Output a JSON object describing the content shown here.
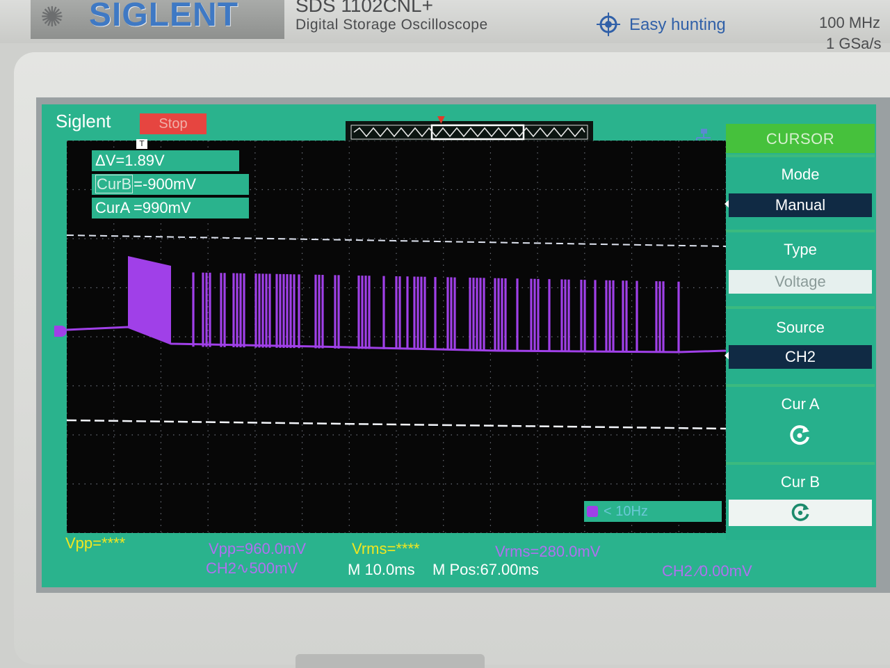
{
  "device": {
    "brand": "SIGLENT",
    "model": "SDS 1102CNL+",
    "subtitle": "Digital Storage Oscilloscope",
    "feature": "Easy hunting",
    "bandwidth": "100 MHz",
    "sample_rate": "1 GSa/s"
  },
  "screen": {
    "brand": "Siglent",
    "run_status": "Stop",
    "trigger_marker": "T"
  },
  "cursor_readouts": {
    "delta_v": "ΔV=1.89V",
    "cur_b_label": "CurB",
    "cur_b_value": "=-900mV",
    "cur_a": "CurA =990mV"
  },
  "frequency_counter": "< 10Hz",
  "menu": {
    "title": "CURSOR",
    "mode_label": "Mode",
    "mode_value": "Manual",
    "type_label": "Type",
    "type_value": "Voltage",
    "source_label": "Source",
    "source_value": "CH2",
    "cur_a_label": "Cur A",
    "cur_b_label": "Cur B"
  },
  "measurements": {
    "ch1_vpp": "Vpp=****",
    "ch2_vpp": "Vpp=960.0mV",
    "ch1_vrms": "Vrms=****",
    "ch2_vrms": "Vrms=280.0mV",
    "ch2_scale": "CH2∿500mV",
    "timebase": "M 10.0ms",
    "position": "M Pos:67.00ms",
    "trigger": "CH2 ∕0.00mV"
  },
  "colors": {
    "screen_bg": "#2ab38d",
    "trace_ch2": "#a040e8",
    "ch1_text": "#f2e620",
    "ch2_text": "#b070f0",
    "stop_badge": "#e64540",
    "menu_title": "#46c13c",
    "selected_value": "#102a44"
  }
}
